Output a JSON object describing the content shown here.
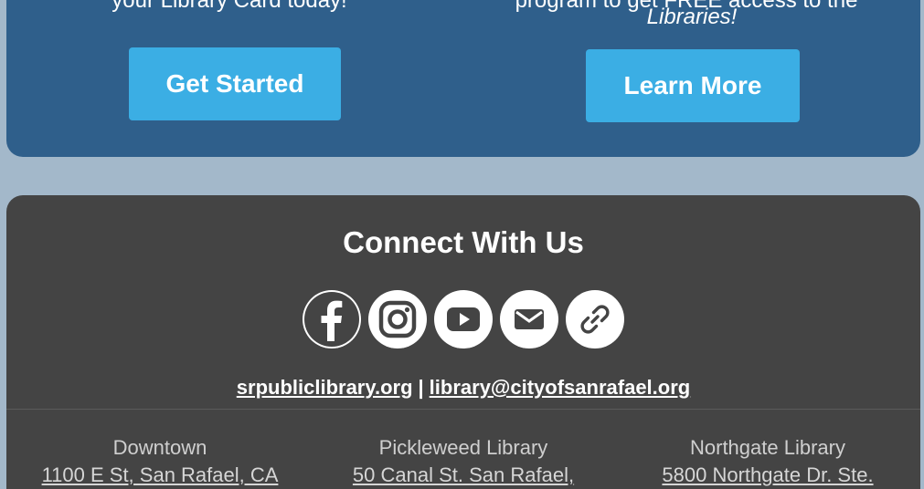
{
  "promo": {
    "left_text": "your Library Card today!",
    "right_text_line1": "program to get FREE access to the",
    "right_text_line2": "Libraries!",
    "get_started_label": "Get Started",
    "learn_more_label": "Learn More"
  },
  "footer": {
    "title": "Connect With Us",
    "social": [
      "facebook-icon",
      "instagram-icon",
      "youtube-icon",
      "email-icon",
      "link-icon"
    ],
    "website_link": "srpubliclibrary.org",
    "separator": "|",
    "email_link": "library@cityofsanrafael.org",
    "branches": [
      {
        "name": "Downtown",
        "address": "1100 E St, San Rafael, CA"
      },
      {
        "name": "Pickleweed Library",
        "address": "50 Canal St. San Rafael,"
      },
      {
        "name": "Northgate Library",
        "address": "5800 Northgate Dr. Ste."
      }
    ]
  },
  "colors": {
    "page_bg": "#a3b8ca",
    "promo_bg": "#2f5f8b",
    "cta_bg": "#3baee4",
    "footer_bg": "#444444"
  }
}
